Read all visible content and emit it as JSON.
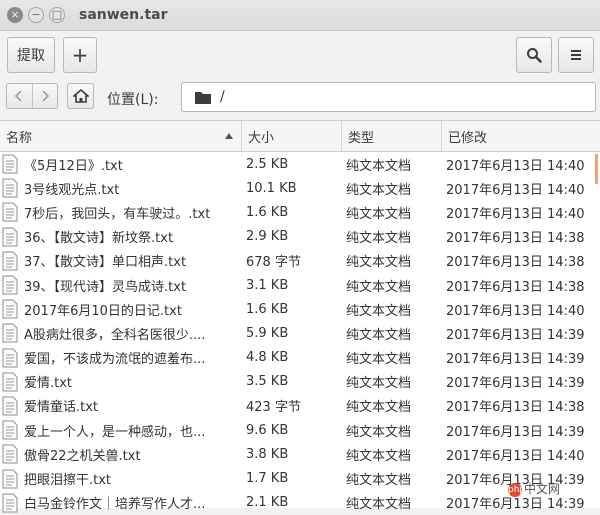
{
  "window": {
    "title": "sanwen.tar",
    "close_glyph": "×",
    "min_glyph": "−",
    "max_glyph": "□"
  },
  "toolbar": {
    "extract_label": "提取",
    "add_label": "+"
  },
  "location": {
    "label": "位置(L):",
    "path": "/"
  },
  "columns": {
    "name": "名称",
    "size": "大小",
    "type": "类型",
    "modified": "已修改"
  },
  "files": [
    {
      "name": "《5月12日》.txt",
      "size": "2.5 KB",
      "type": "纯文本文档",
      "modified": "2017年6月13日 14:40"
    },
    {
      "name": "3号线观光点.txt",
      "size": "10.1 KB",
      "type": "纯文本文档",
      "modified": "2017年6月13日 14:40"
    },
    {
      "name": "7秒后，我回头，有车驶过。.txt",
      "size": "1.6 KB",
      "type": "纯文本文档",
      "modified": "2017年6月13日 14:40"
    },
    {
      "name": "36、【散文诗】新坟祭.txt",
      "size": "2.9 KB",
      "type": "纯文本文档",
      "modified": "2017年6月13日 14:38"
    },
    {
      "name": "37、【散文诗】单口相声.txt",
      "size": "678 字节",
      "type": "纯文本文档",
      "modified": "2017年6月13日 14:38"
    },
    {
      "name": "39、【现代诗】灵鸟成诗.txt",
      "size": "3.1 KB",
      "type": "纯文本文档",
      "modified": "2017年6月13日 14:38"
    },
    {
      "name": "2017年6月10日的日记.txt",
      "size": "1.6 KB",
      "type": "纯文本文档",
      "modified": "2017年6月13日 14:40"
    },
    {
      "name": "A股病灶很多，全科名医很少....",
      "size": "5.9 KB",
      "type": "纯文本文档",
      "modified": "2017年6月13日 14:39"
    },
    {
      "name": "爱国，不该成为流氓的遮羞布...",
      "size": "4.8 KB",
      "type": "纯文本文档",
      "modified": "2017年6月13日 14:39"
    },
    {
      "name": "爱情.txt",
      "size": "3.5 KB",
      "type": "纯文本文档",
      "modified": "2017年6月13日 14:39"
    },
    {
      "name": "爱情童话.txt",
      "size": "423 字节",
      "type": "纯文本文档",
      "modified": "2017年6月13日 14:38"
    },
    {
      "name": "爱上一个人，是一种感动，也...",
      "size": "9.6 KB",
      "type": "纯文本文档",
      "modified": "2017年6月13日 14:39"
    },
    {
      "name": "傲骨22之机关兽.txt",
      "size": "3.8 KB",
      "type": "纯文本文档",
      "modified": "2017年6月13日 14:40"
    },
    {
      "name": "把眼泪擦干.txt",
      "size": "1.7 KB",
      "type": "纯文本文档",
      "modified": "2017年6月13日 14:39"
    },
    {
      "name": "白马金铃作文｜培养写作人才...",
      "size": "2.1 KB",
      "type": "纯文本文档",
      "modified": "2017年6月13日 14:39"
    }
  ],
  "watermark": {
    "badge": "php",
    "text": "中文网"
  }
}
